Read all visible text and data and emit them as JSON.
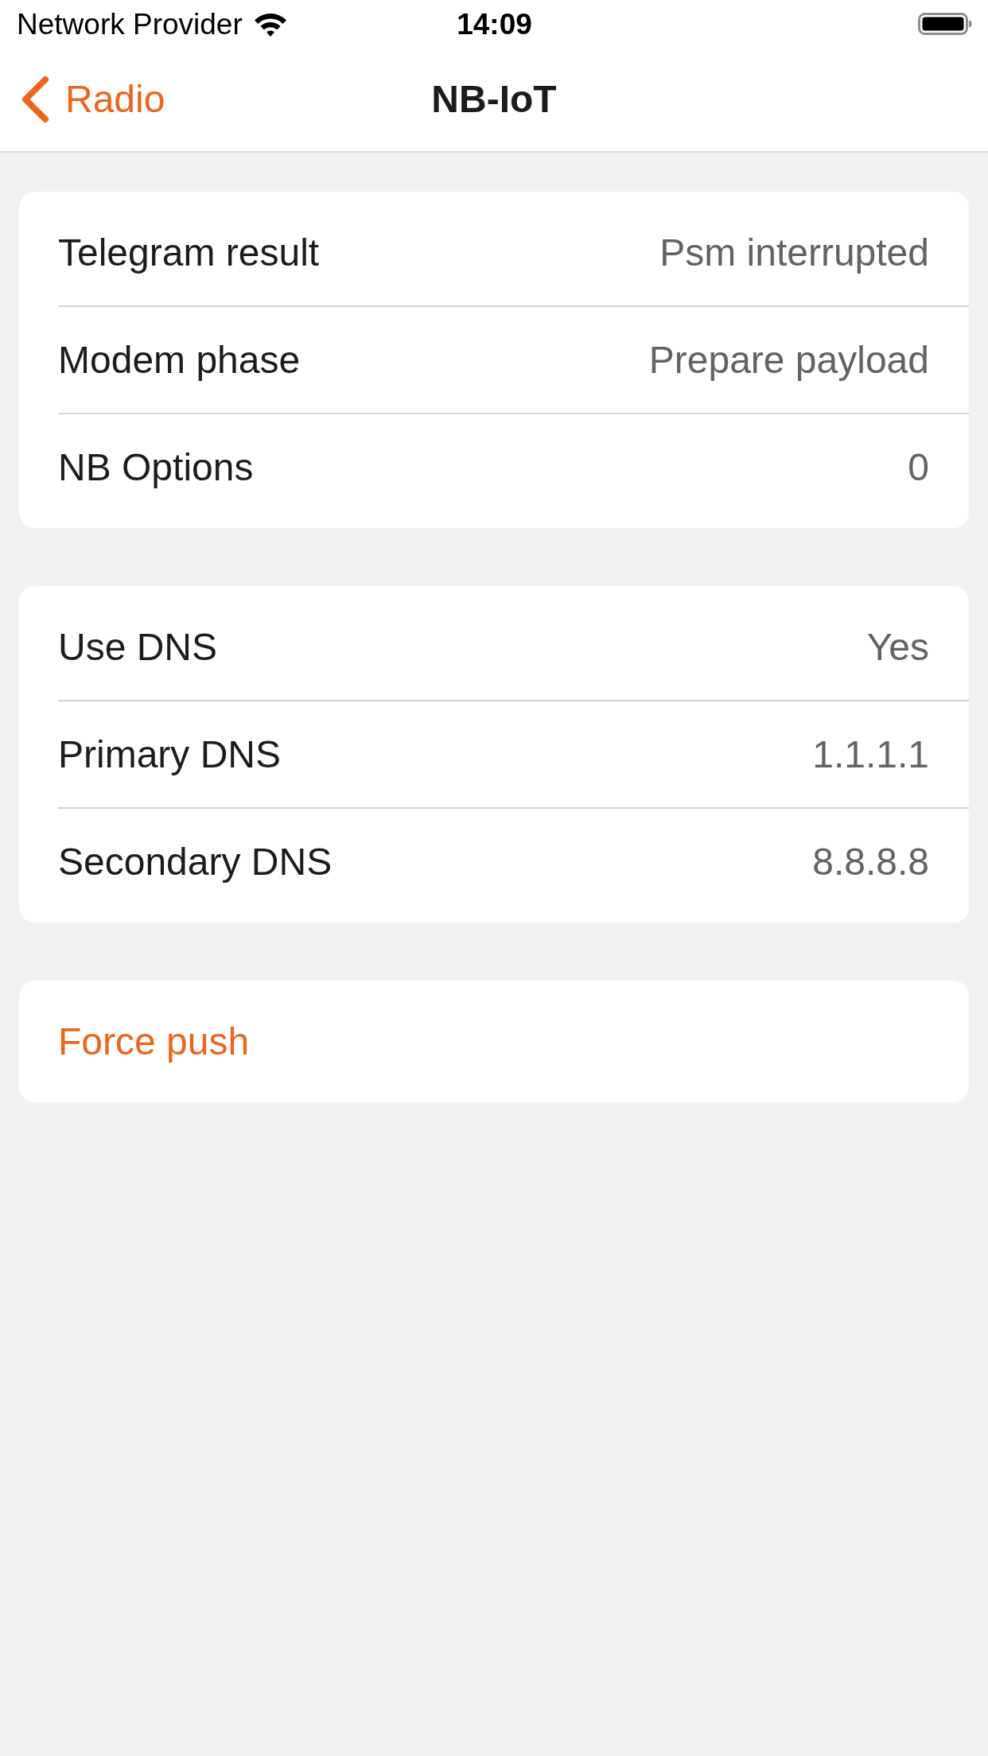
{
  "status_bar": {
    "carrier": "Network Provider",
    "time": "14:09"
  },
  "nav_bar": {
    "back_label": "Radio",
    "title": "NB-IoT"
  },
  "sections": [
    {
      "rows": [
        {
          "kind": "detail",
          "label": "Telegram result",
          "value": "Psm interrupted"
        },
        {
          "kind": "detail",
          "label": "Modem phase",
          "value": "Prepare payload"
        },
        {
          "kind": "detail",
          "label": "NB Options",
          "value": "0"
        }
      ]
    },
    {
      "rows": [
        {
          "kind": "detail",
          "label": "Use DNS",
          "value": "Yes"
        },
        {
          "kind": "detail",
          "label": "Primary DNS",
          "value": "1.1.1.1"
        },
        {
          "kind": "detail",
          "label": "Secondary DNS",
          "value": "8.8.8.8"
        }
      ]
    },
    {
      "rows": [
        {
          "kind": "action",
          "label": "Force push"
        }
      ]
    }
  ]
}
